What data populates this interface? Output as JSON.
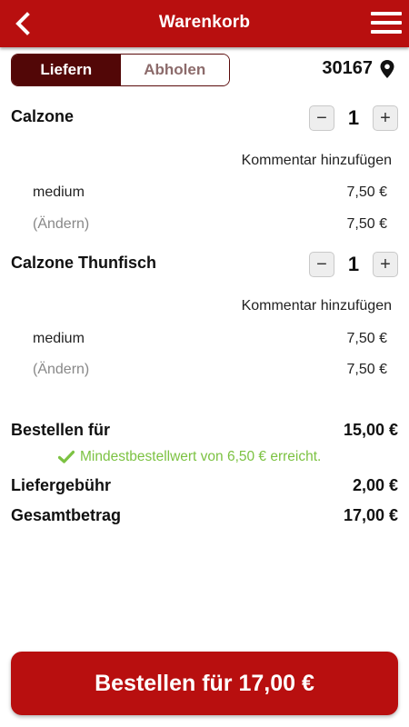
{
  "header": {
    "title": "Warenkorb",
    "back_icon": "chevron-left-icon",
    "menu_icon": "hamburger-menu-icon"
  },
  "delivery_toggle": {
    "options": [
      "Liefern",
      "Abholen"
    ],
    "selected": "Liefern"
  },
  "location": {
    "zip": "30167",
    "icon": "map-pin-icon"
  },
  "cart": {
    "items": [
      {
        "name": "Calzone",
        "quantity": "1",
        "comment_label": "Kommentar hinzufügen",
        "options": [
          {
            "label": "medium",
            "price": "7,50 €"
          },
          {
            "label": "(Ändern)",
            "price": "7,50 €"
          }
        ]
      },
      {
        "name": "Calzone Thunfisch",
        "quantity": "1",
        "comment_label": "Kommentar hinzufügen",
        "options": [
          {
            "label": "medium",
            "price": "7,50 €"
          },
          {
            "label": "(Ändern)",
            "price": "7,50 €"
          }
        ]
      }
    ],
    "decrement_symbol": "−",
    "increment_symbol": "+"
  },
  "summary": {
    "order_for_label": "Bestellen für",
    "order_for_value": "15,00 €",
    "minimum_note": "Mindestbestellwert von 6,50 € erreicht.",
    "delivery_fee_label": "Liefergebühr",
    "delivery_fee_value": "2,00 €",
    "total_label": "Gesamtbetrag",
    "total_value": "17,00 €"
  },
  "order_button": {
    "label": "Bestellen für 17,00 €"
  },
  "colors": {
    "brand_red": "#b80f0f",
    "toggle_active": "#520707",
    "success_green": "#7cc242"
  }
}
